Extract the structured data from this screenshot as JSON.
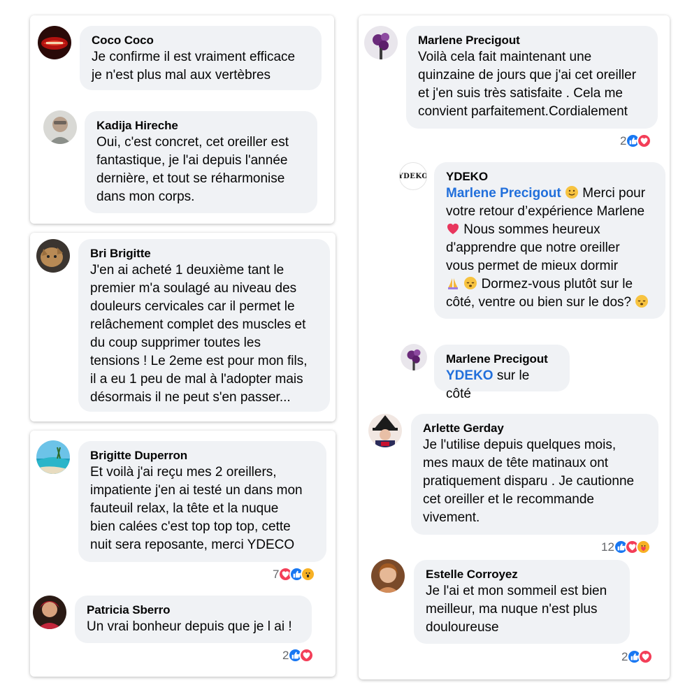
{
  "comments": {
    "c1": {
      "name": "Coco Coco",
      "text": "Je confirme il est vraiment efficace\nje n'est plus mal aux vertèbres"
    },
    "c2": {
      "name": "Kadija Hireche",
      "text": "Oui, c'est concret,  cet oreiller est\nfantastique,  je l'ai depuis l'année\ndernière,  et tout se réharmonise\ndans mon corps."
    },
    "c3": {
      "name": "Bri Brigitte",
      "text": "J'en ai acheté 1 deuxième tant le\npremier m'a soulagé au niveau des\ndouleurs cervicales car il permet le\nrelâchement complet des muscles et\ndu coup supprimer toutes les\ntensions ! Le 2eme est pour mon fils,\nil a eu 1 peu de mal à l'adopter mais\ndésormais il ne peut s'en passer..."
    },
    "c4": {
      "name": "Brigitte Duperron",
      "text": "Et voilà j'ai reçu mes 2 oreillers,\nimpatiente j'en ai testé un dans mon\nfauteuil relax,  la tête et la nuque\nbien calées c'est top top top,  cette\nnuit sera reposante,  merci YDECO",
      "reaction_count": "7"
    },
    "c5": {
      "name": "Patricia Sberro",
      "text": "Un vrai bonheur depuis que je l ai !",
      "reaction_count": "2"
    },
    "c6": {
      "name": "Marlene Precigout",
      "text": "Voilà cela fait maintenant une\nquinzaine de jours que j'ai cet oreiller\net j'en suis très satisfaite . Cela me\nconvient parfaitement.Cordialement",
      "reaction_count": "2"
    },
    "c7": {
      "name": "YDEKO",
      "avatar_text": "YDEKO",
      "mention": "Marlene Precigout",
      "line1_rest": "Merci pour",
      "line2": "votre retour d’expérience Marlene",
      "line3": "Nous sommes heureux",
      "line4": "d'apprendre que notre oreiller",
      "line5": "vous permet de mieux dormir",
      "line6": "Dormez-vous plutôt sur le",
      "line7": "côté, ventre ou bien sur le dos?"
    },
    "c8": {
      "name": "Marlene Precigout",
      "mention": "YDEKO",
      "rest": "sur le côté"
    },
    "c9": {
      "name": "Arlette Gerday",
      "text": "Je l'utilise depuis quelques mois,\nmes maux de tête matinaux ont\npratiquement disparu . Je cautionne\ncet oreiller et le recommande\nvivement.",
      "reaction_count": "12"
    },
    "c10": {
      "name": "Estelle Corroyez",
      "text": "Je l'ai et mon sommeil est bien\nmeilleur, ma nuque n'est plus\ndouloureuse",
      "reaction_count": "2"
    }
  },
  "colors": {
    "bubble": "#f0f2f5",
    "mention": "#216fdb",
    "like": "#1877f2",
    "love": "#f33e58",
    "wow": "#f7b125"
  }
}
